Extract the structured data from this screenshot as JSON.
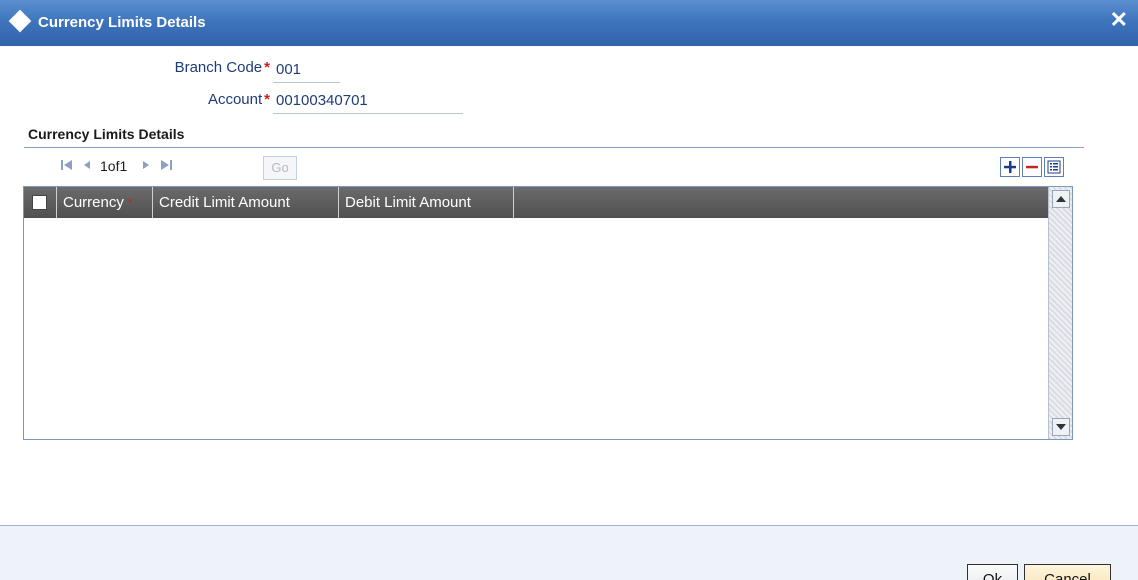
{
  "window": {
    "title": "Currency Limits Details",
    "close_glyph": "✕"
  },
  "form": {
    "branch_code_label": "Branch Code",
    "branch_code_value": "001",
    "account_label": "Account",
    "account_value": "00100340701",
    "required_marker": "*"
  },
  "section": {
    "title": "Currency Limits Details"
  },
  "pager": {
    "page_text": "1of1",
    "go_label": "Go"
  },
  "grid": {
    "columns": [
      "Currency",
      "Credit Limit Amount",
      "Debit Limit Amount"
    ],
    "required_marker": "*",
    "rows": []
  },
  "buttons": {
    "ok_label": "Ok",
    "cancel_label": "Cancel"
  },
  "colors": {
    "title_bar": "#3f75bd",
    "grid_header": "#5c5c5c",
    "required": "#d41a1a",
    "label": "#1f3c7a"
  }
}
